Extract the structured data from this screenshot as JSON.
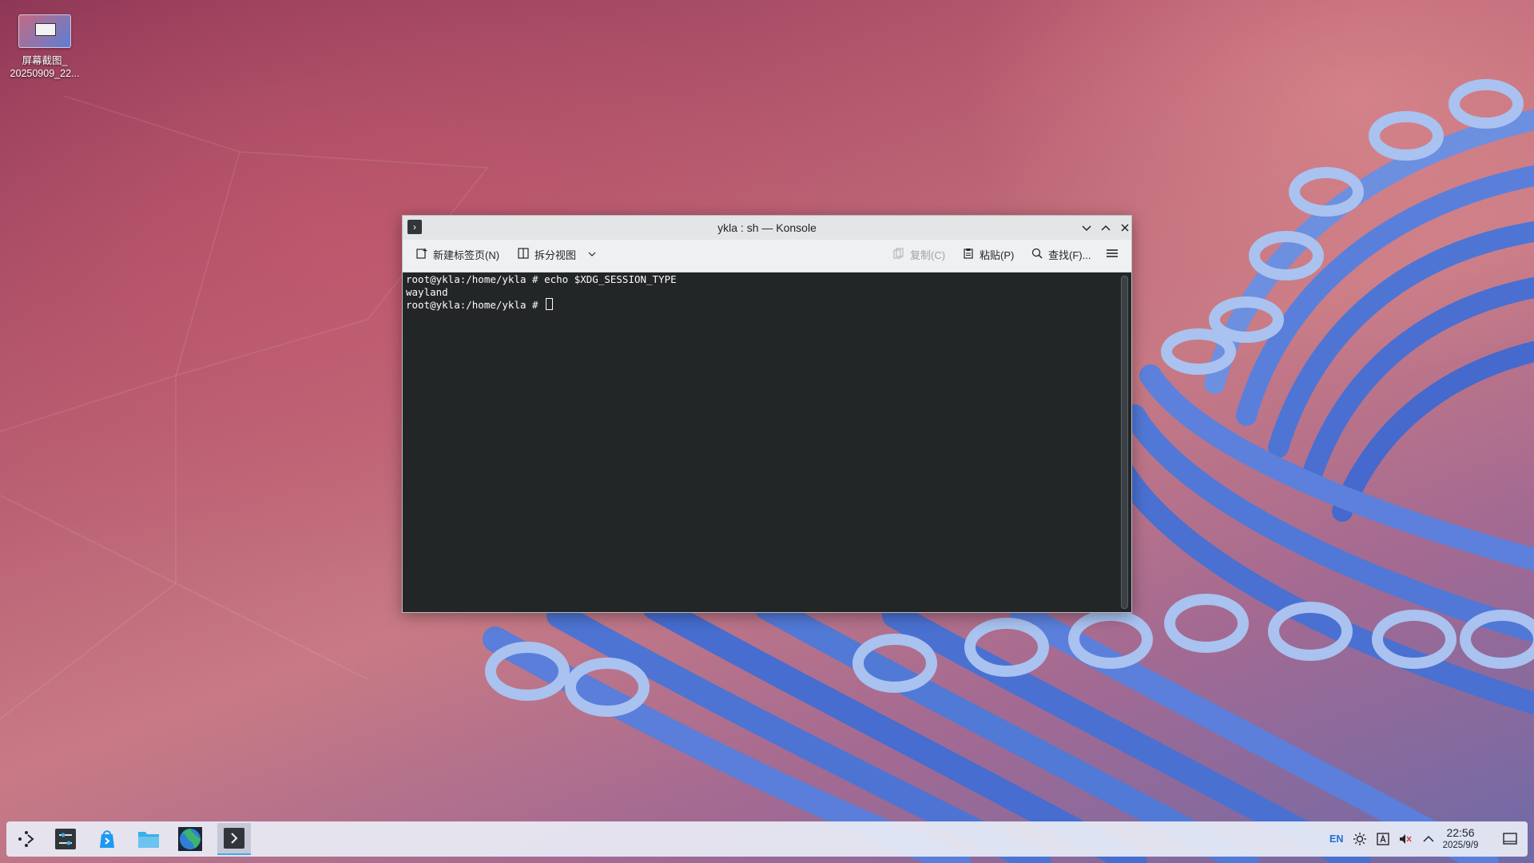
{
  "desktop": {
    "icon_label_line1": "屏幕截图_",
    "icon_label_line2": "20250909_22..."
  },
  "window": {
    "title": "ykla : sh — Konsole",
    "toolbar": {
      "new_tab": "新建标签页(N)",
      "split_view": "拆分视图",
      "copy": "复制(C)",
      "paste": "粘贴(P)",
      "find": "查找(F)..."
    },
    "terminal": {
      "line1": "root@ykla:/home/ykla # echo $XDG_SESSION_TYPE",
      "line2": "wayland",
      "line3": "root@ykla:/home/ykla # "
    }
  },
  "taskbar": {
    "apps": [
      "application-launcher",
      "system-settings",
      "discover",
      "dolphin",
      "browser",
      "konsole"
    ],
    "tray_lang": "EN",
    "time": "22:56",
    "date": "2025/9/9"
  },
  "colors": {
    "terminal_bg": "#232627",
    "accent": "#3daee9"
  }
}
